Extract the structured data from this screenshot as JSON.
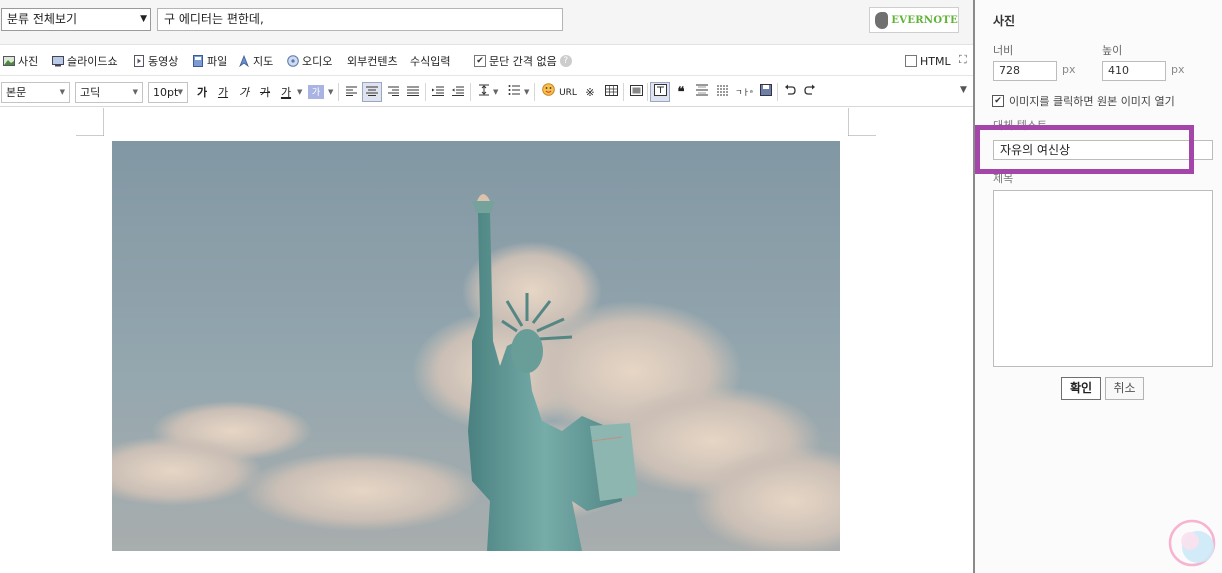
{
  "header": {
    "category_value": "분류 전체보기",
    "post_title": "구 에디터는 편한데,",
    "evernote_label": "EVERNOTE"
  },
  "insert_toolbar": {
    "items": [
      {
        "label": "사진",
        "icon": "photo-icon"
      },
      {
        "label": "슬라이드쇼",
        "icon": "slideshow-icon"
      },
      {
        "label": "동영상",
        "icon": "video-icon"
      },
      {
        "label": "파일",
        "icon": "file-icon"
      },
      {
        "label": "지도",
        "icon": "map-icon"
      },
      {
        "label": "오디오",
        "icon": "audio-icon"
      },
      {
        "label": "외부컨텐츠",
        "icon": ""
      },
      {
        "label": "수식입력",
        "icon": ""
      }
    ],
    "no_paragraph_gap_label": "문단 간격 없음",
    "no_paragraph_gap_checked": true,
    "html_label": "HTML",
    "html_checked": false
  },
  "format_toolbar": {
    "paragraph_style": "본문",
    "font_family": "고딕",
    "font_size": "10pt",
    "bold": "가",
    "underline": "가",
    "italic": "가",
    "strike": "가",
    "font_color": "가",
    "bg_color": "가",
    "url": "URL",
    "icons": [
      "align-left-icon",
      "align-center-icon",
      "align-right-icon",
      "align-justify-icon",
      "indent-icon",
      "outdent-icon",
      "line-height-icon",
      "list-icon",
      "emoticon-icon",
      "url-icon",
      "special-char-icon",
      "table-icon",
      "box-icon",
      "text-box-icon",
      "quote-icon",
      "divider-icon",
      "line-icon",
      "spell-check-icon",
      "save-icon",
      "undo-icon",
      "redo-icon"
    ]
  },
  "panel": {
    "title": "사진",
    "width_label": "너비",
    "height_label": "높이",
    "width_value": "728",
    "height_value": "410",
    "unit": "px",
    "link_original_label": "이미지를 클릭하면 원본 이미지 열기",
    "link_original_checked": true,
    "alt_label": "대체 텍스트",
    "alt_value": "자유의 여신상",
    "caption_label": "제목",
    "caption_value": "",
    "ok_label": "확인",
    "cancel_label": "취소"
  },
  "colors": {
    "highlight": "#a345a9",
    "evernote_green": "#5fb336",
    "sky": "#7f98a4",
    "statue": "#4f8f8c"
  }
}
